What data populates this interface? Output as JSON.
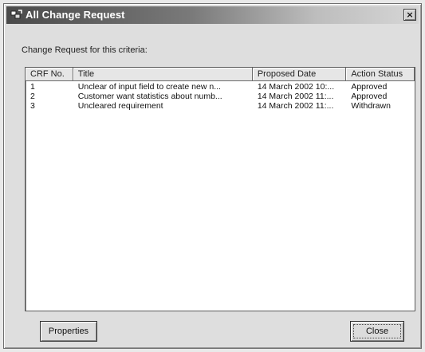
{
  "window": {
    "title": "All Change Request",
    "close_glyph": "×",
    "icon": "app-icon"
  },
  "criteria_label": "Change Request for this criteria:",
  "list": {
    "columns": [
      "CRF No.",
      "Title",
      "Proposed Date",
      "Action Status"
    ],
    "rows": [
      {
        "no": "1",
        "title": "Unclear of input field to create new n...",
        "date": "14 March 2002  10:...",
        "status": "Approved"
      },
      {
        "no": "2",
        "title": "Customer want statistics about numb...",
        "date": "14 March 2002  11:...",
        "status": "Approved"
      },
      {
        "no": "3",
        "title": "Uncleared requirement",
        "date": "14 March 2002  11:...",
        "status": "Withdrawn"
      }
    ]
  },
  "buttons": {
    "properties": "Properties",
    "close": "Close"
  }
}
